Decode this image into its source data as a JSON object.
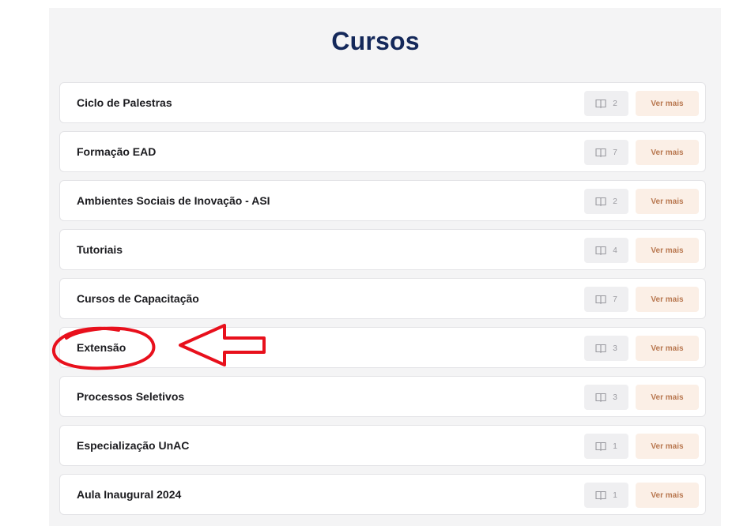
{
  "page": {
    "title": "Cursos"
  },
  "courses": [
    {
      "name": "Ciclo de Palestras",
      "count": "2",
      "button": "Ver mais"
    },
    {
      "name": "Formação EAD",
      "count": "7",
      "button": "Ver mais"
    },
    {
      "name": "Ambientes Sociais de Inovação - ASI",
      "count": "2",
      "button": "Ver mais"
    },
    {
      "name": "Tutoriais",
      "count": "4",
      "button": "Ver mais"
    },
    {
      "name": "Cursos de Capacitação",
      "count": "7",
      "button": "Ver mais"
    },
    {
      "name": "Extensão",
      "count": "3",
      "button": "Ver mais"
    },
    {
      "name": "Processos Seletivos",
      "count": "3",
      "button": "Ver mais"
    },
    {
      "name": "Especialização UnAC",
      "count": "1",
      "button": "Ver mais"
    },
    {
      "name": "Aula Inaugural 2024",
      "count": "1",
      "button": "Ver mais"
    }
  ],
  "icons": {
    "count": "book-icon"
  },
  "colors": {
    "title": "#14285a",
    "button_bg": "#fbefe6",
    "button_text": "#b8774f",
    "annotation": "#e8101c"
  }
}
